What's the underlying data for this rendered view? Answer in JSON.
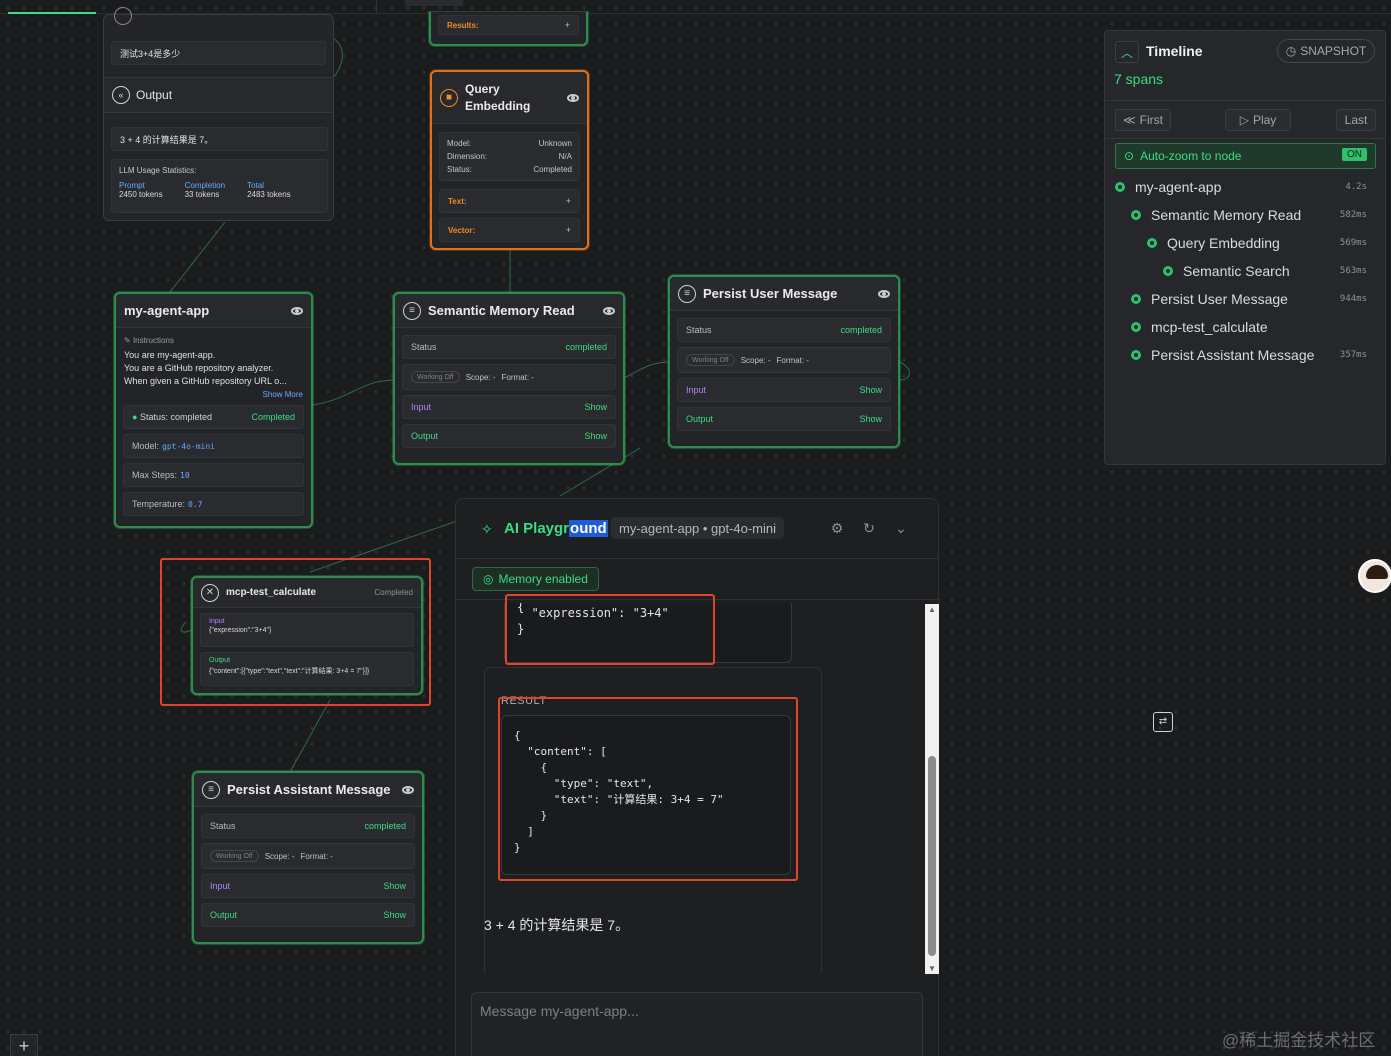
{
  "colors": {
    "accent": "#3ddc84",
    "highlight_border": "#e0442a",
    "embedding_border": "#e0701f"
  },
  "top_input": {
    "text": "测试3+4是多少"
  },
  "output_node": {
    "title": "Output",
    "result": "3 + 4 的计算结果是 7。",
    "usage_title": "LLM Usage Statistics:",
    "prompt_label": "Prompt",
    "prompt_value": "2450 tokens",
    "completion_label": "Completion",
    "completion_value": "33 tokens",
    "total_label": "Total",
    "total_value": "2483 tokens"
  },
  "results_node": {
    "label": "Results:",
    "plus": "+"
  },
  "embedding_node": {
    "title_line1": "Query",
    "title_line2": "Embedding",
    "model_label": "Model:",
    "model_value": "Unknown",
    "dimension_label": "Dimension:",
    "dimension_value": "N/A",
    "status_label": "Status:",
    "status_value": "Completed",
    "text_label": "Text:",
    "vector_label": "Vector:",
    "plus": "+"
  },
  "agent_node": {
    "title": "my-agent-app",
    "instructions_label": "Instructions",
    "instructions_line1": "You are my-agent-app.",
    "instructions_line2": "You are a GitHub repository analyzer.",
    "instructions_line3": "When given a GitHub repository URL o...",
    "show_more": "Show More",
    "status_label": "Status: completed",
    "status_value": "Completed",
    "model_label": "Model:",
    "model_value": "gpt-4o-mini",
    "steps_label": "Max Steps:",
    "steps_value": "10",
    "temp_label": "Temperature:",
    "temp_value": "0.7"
  },
  "memory_read_node": {
    "title": "Semantic Memory Read",
    "status_label": "Status",
    "status_value": "completed",
    "working": "Working Off",
    "scope": "Scope: -",
    "format": "Format: -",
    "input_label": "Input",
    "output_label": "Output",
    "show": "Show"
  },
  "persist_user_node": {
    "title": "Persist User Message",
    "status_label": "Status",
    "status_value": "completed",
    "working": "Working Off",
    "scope": "Scope: -",
    "format": "Format: -",
    "input_label": "Input",
    "output_label": "Output",
    "show": "Show"
  },
  "mcp_node": {
    "title": "mcp-test_calculate",
    "status": "Completed",
    "input_label": "Input",
    "input_value": "{\"expression\":\"3+4\"}",
    "output_label": "Output",
    "output_value": "{\"content\":[{\"type\":\"text\",\"text\":\"计算结果: 3+4 = 7\"}]}"
  },
  "persist_assistant_node": {
    "title": "Persist Assistant Message",
    "status_label": "Status",
    "status_value": "completed",
    "working": "Working Off",
    "scope": "Scope: -",
    "format": "Format: -",
    "input_label": "Input",
    "output_label": "Output",
    "show": "Show"
  },
  "timeline": {
    "title": "Timeline",
    "spans": "7 spans",
    "snapshot": "SNAPSHOT",
    "first": "First",
    "play": "Play",
    "last": "Last",
    "autozoom": "Auto-zoom to node",
    "autozoom_state": "ON",
    "items": [
      {
        "label": "my-agent-app",
        "duration": "4.2s"
      },
      {
        "label": "Semantic Memory Read",
        "duration": "582ms"
      },
      {
        "label": "Query Embedding",
        "duration": "569ms"
      },
      {
        "label": "Semantic Search",
        "duration": "563ms"
      },
      {
        "label": "Persist User Message",
        "duration": "944ms"
      },
      {
        "label": "mcp-test_calculate",
        "duration": ""
      },
      {
        "label": "Persist Assistant Message",
        "duration": "357ms"
      }
    ]
  },
  "playground": {
    "title_part1": "AI Playgr",
    "title_part2": "ound",
    "badge": "my-agent-app • gpt-4o-mini",
    "memory": "Memory enabled",
    "args_code": "  \"expression\": \"3+4\"\n}",
    "result_label": "RESULT",
    "result_code": "{\n  \"content\": [\n    {\n      \"type\": \"text\",\n      \"text\": \"计算结果: 3+4 = 7\"\n    }\n  ]\n}",
    "answer": "3 + 4 的计算结果是 7。",
    "placeholder": "Message my-agent-app..."
  },
  "watermark": "@稀土掘金技术社区",
  "zoom_plus": "+"
}
